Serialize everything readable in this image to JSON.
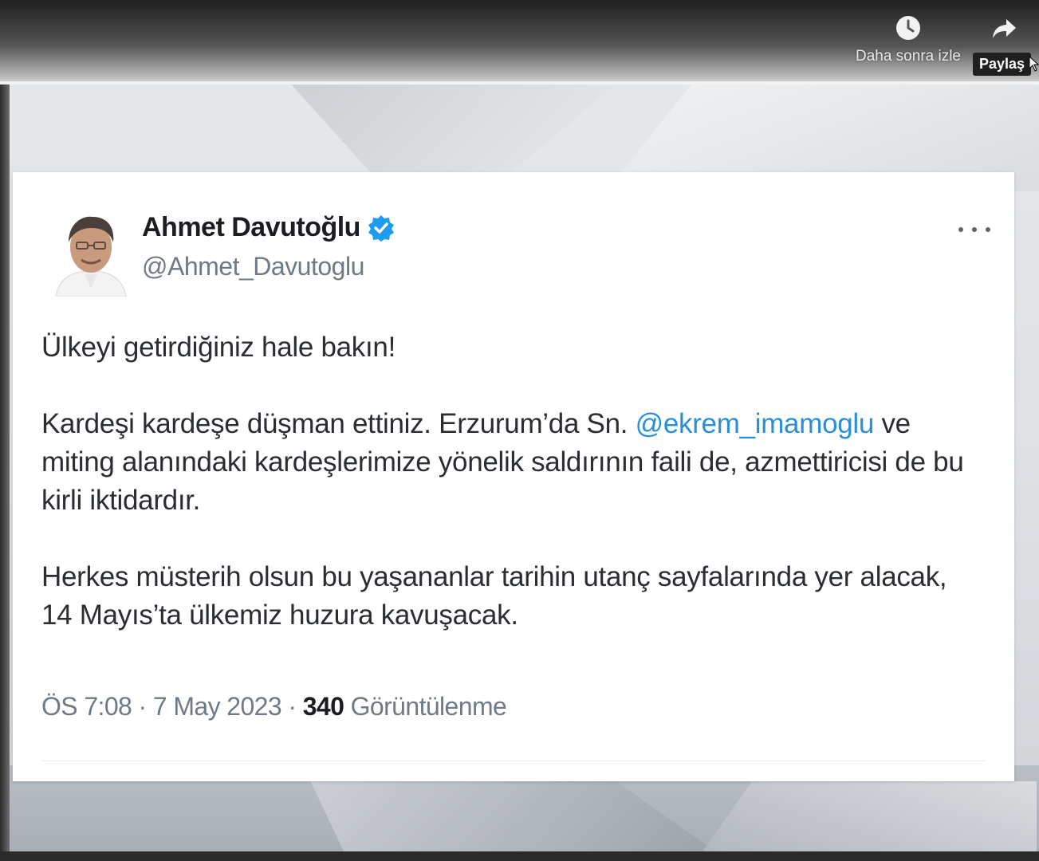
{
  "video_overlay": {
    "watch_later_label": "Daha sonra izle",
    "watch_later_icon": "clock-icon",
    "share_icon": "share-arrow-icon",
    "share_tooltip": "Paylaş"
  },
  "tweet": {
    "display_name": "Ahmet Davutoğlu",
    "verified": true,
    "verified_color": "#1d9bf0",
    "handle": "@Ahmet_Davutoglu",
    "more_icon": "more-dots-icon",
    "paragraph_1": "Ülkeyi getirdiğiniz hale bakın!",
    "paragraph_2_before_mention": "Kardeşi kardeşe düşman ettiniz. Erzurum’da Sn. ",
    "mention": "@ekrem_imamoglu",
    "paragraph_2_after_mention": " ve miting alanındaki kardeşlerimize yönelik saldırının faili de, azmettiricisi de bu kirli iktidardır.",
    "paragraph_3": "Herkes müsterih olsun bu yaşananlar tarihin utanç sayfalarında yer alacak, 14 Mayıs’ta ülkemiz huzura kavuşacak.",
    "time": "ÖS 7:08",
    "separator": " · ",
    "date": "7 May 2023",
    "views_count": "340",
    "views_label": "Görüntülenme",
    "mention_color": "#2a8fd9"
  }
}
